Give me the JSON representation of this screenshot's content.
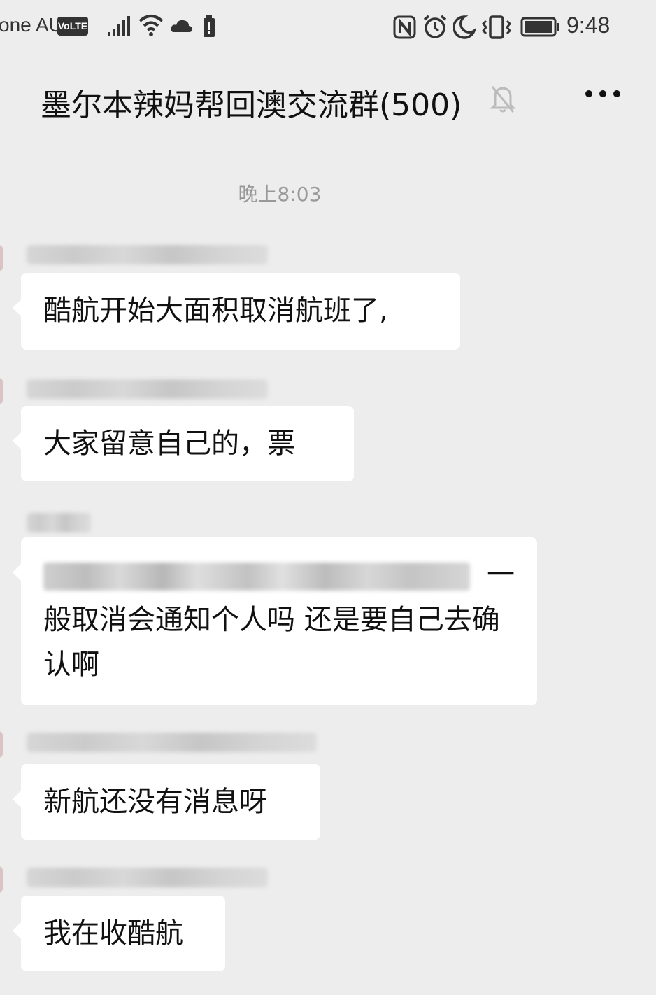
{
  "status_bar": {
    "carrier": "one AU",
    "volte": "VoLTE",
    "time": "9:48"
  },
  "chat": {
    "title": "墨尔本辣妈帮回澳交流群(500)",
    "timestamp": "晚上8:03"
  },
  "messages": [
    {
      "text": "酷航开始大面积取消航班了,"
    },
    {
      "text": "大家留意自己的，票"
    },
    {
      "text_line1_tail": "一",
      "text_rest": "般取消会通知个人吗 还是要自己去确认啊"
    },
    {
      "text": "新航还没有消息呀"
    },
    {
      "text": "我在收酷航"
    }
  ],
  "icons": {
    "signal": "signal-icon",
    "wifi": "wifi-icon",
    "cloud": "cloud-icon",
    "battery_alert": "battery-alert-icon",
    "nfc": "nfc-icon",
    "alarm": "alarm-icon",
    "moon": "do-not-disturb-icon",
    "vibrate": "vibrate-icon",
    "battery": "battery-icon",
    "mute": "mute-bell-icon",
    "more": "more-icon"
  }
}
